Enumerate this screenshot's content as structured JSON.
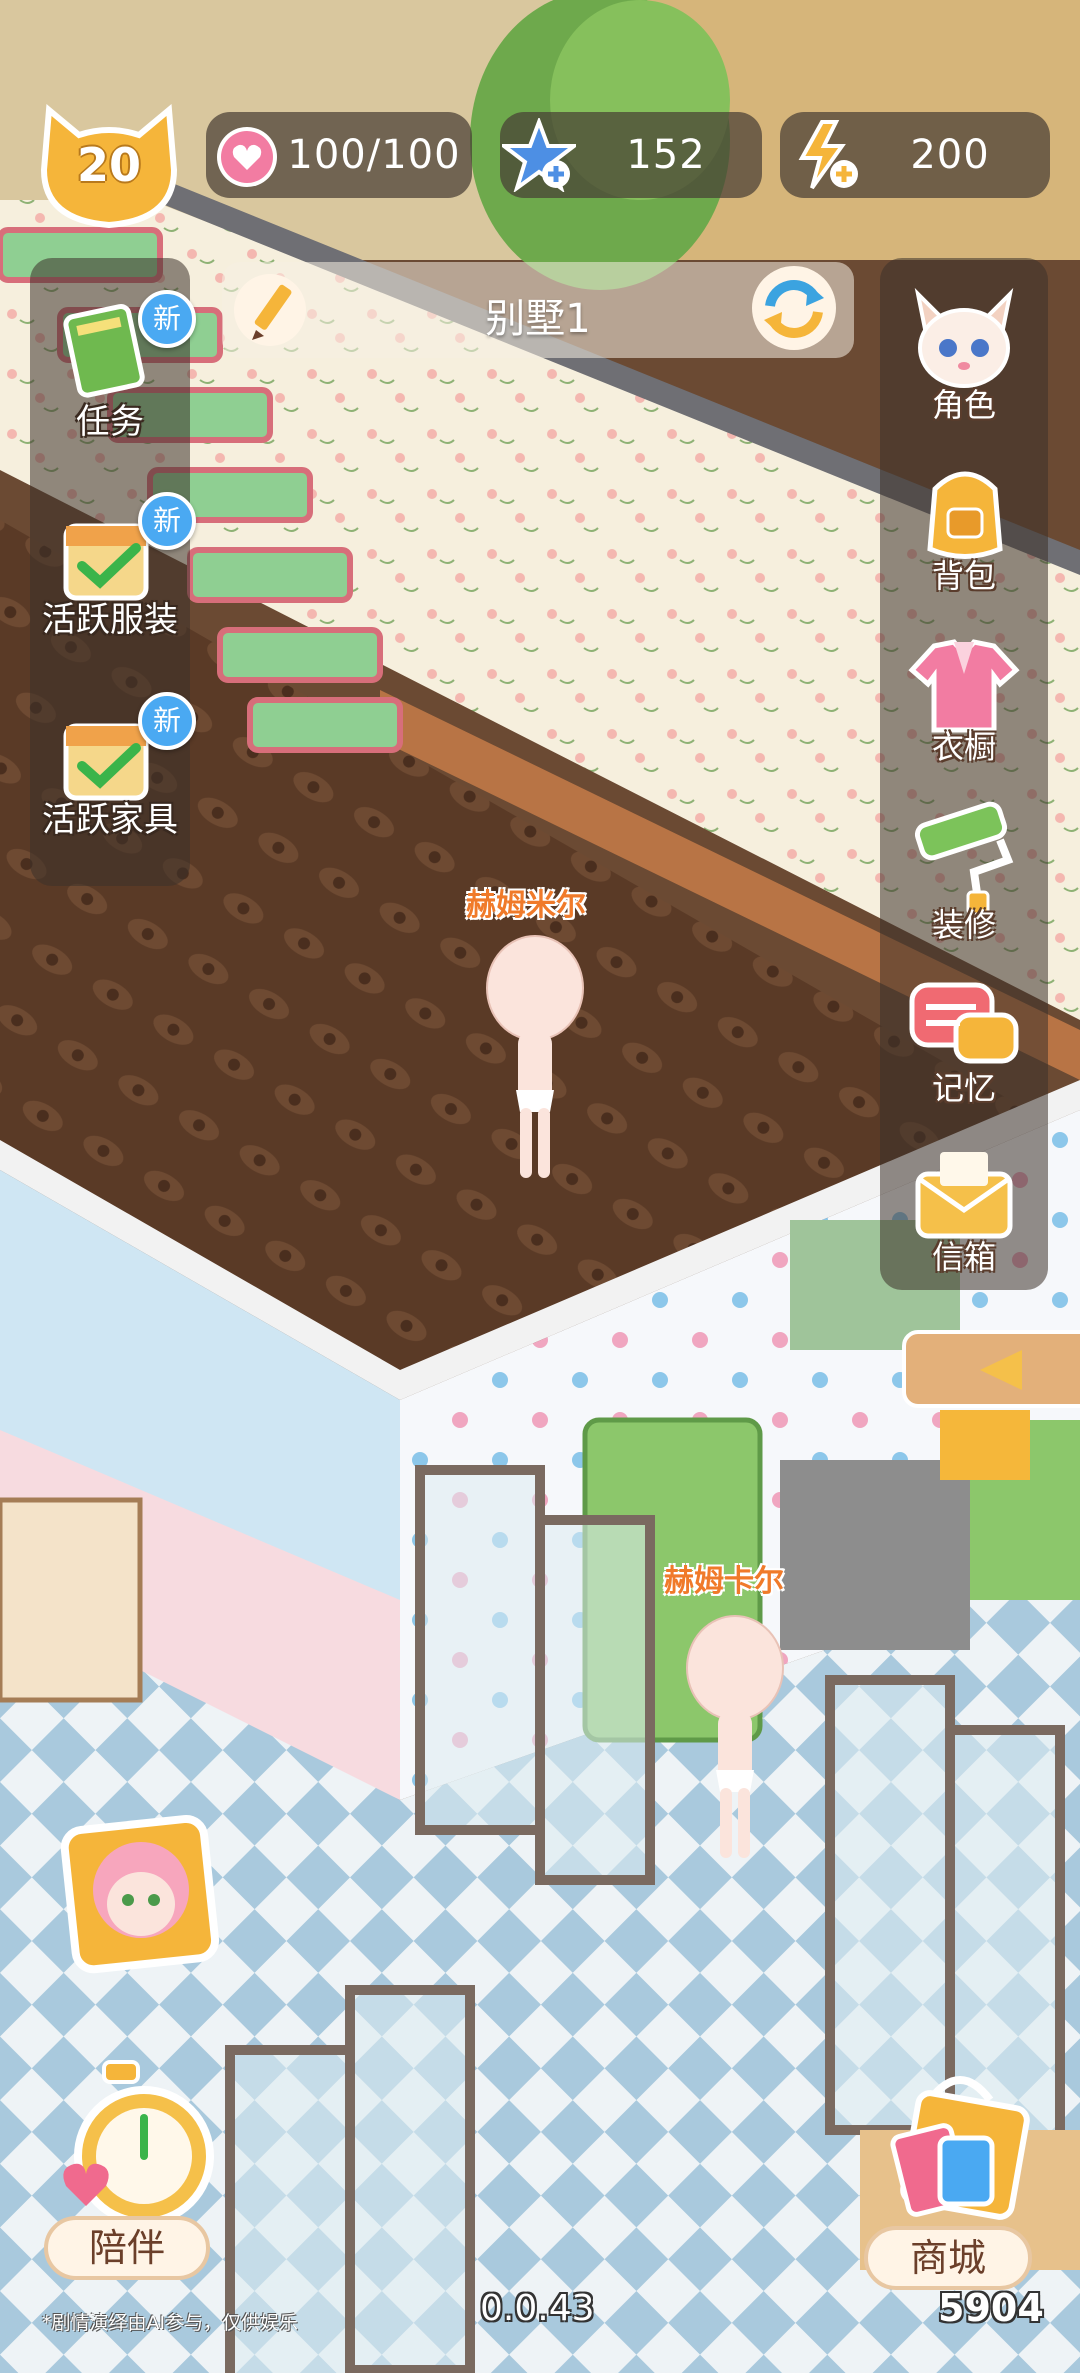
{
  "hud": {
    "level": "20",
    "hearts": "100/100",
    "stars": "152",
    "energy": "200"
  },
  "room": {
    "name": "别墅1"
  },
  "left_menu": [
    {
      "label": "任务",
      "badge": "新",
      "icon": "quest-book-icon"
    },
    {
      "label": "活跃服装",
      "badge": "新",
      "icon": "calendar-check-icon"
    },
    {
      "label": "活跃家具",
      "badge": "新",
      "icon": "calendar-check-icon"
    }
  ],
  "right_menu": [
    {
      "label": "角色",
      "icon": "fox-character-icon"
    },
    {
      "label": "背包",
      "icon": "backpack-icon"
    },
    {
      "label": "衣橱",
      "icon": "shirt-icon"
    },
    {
      "label": "装修",
      "icon": "paint-roller-icon"
    },
    {
      "label": "记忆",
      "icon": "chat-bubble-icon"
    },
    {
      "label": "信箱",
      "icon": "mail-envelope-icon"
    }
  ],
  "characters": [
    {
      "name": "赫姆米尔"
    },
    {
      "name": "赫姆卡尔"
    }
  ],
  "bottom": {
    "companion_label": "陪伴",
    "shop_label": "商城",
    "version": "0.0.43",
    "coins": "5904",
    "disclaimer": "*剧情演绎由AI参与，仅供娱乐"
  },
  "colors": {
    "accent_gold": "#f5b53a",
    "new_badge": "#4aa9f2",
    "char_name": "#f07a2a"
  }
}
